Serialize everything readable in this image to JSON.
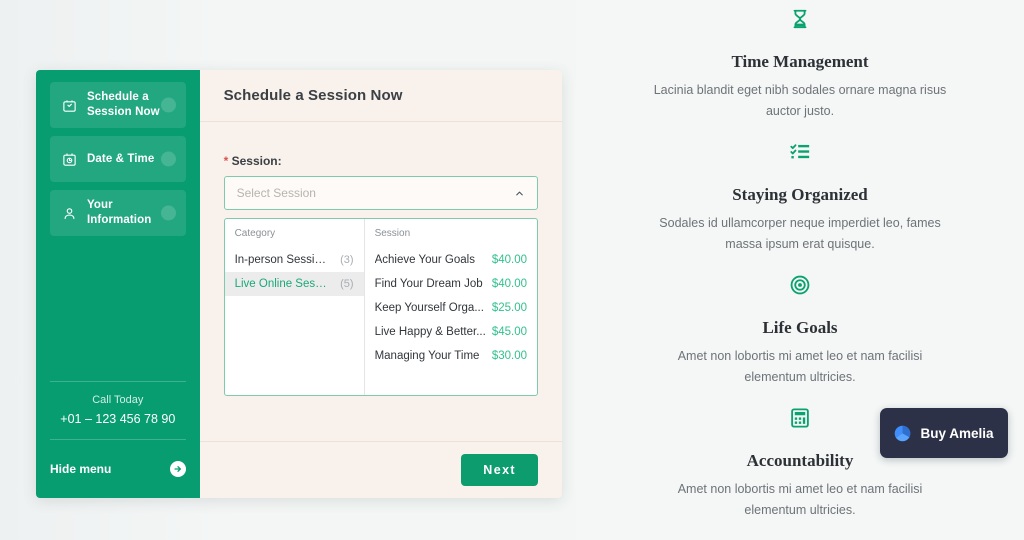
{
  "theme": {
    "sidebar_green": "#089d71",
    "panel_cream": "#f9f1eb",
    "accent_green": "#0d9c6e",
    "price_green": "#33c08d",
    "dark_navy": "#2d3148"
  },
  "booking": {
    "sidebar": {
      "nav_items": [
        {
          "label": "Schedule a Session Now",
          "icon": "bag-icon"
        },
        {
          "label": "Date & Time",
          "icon": "calendar-clock-icon"
        },
        {
          "label": "Your Information",
          "icon": "person-icon"
        }
      ],
      "call_title": "Call Today",
      "call_phone": "+01 – 123 456 78 90",
      "hide_menu_label": "Hide menu",
      "hide_menu_icon": "arrow-right-circle-icon"
    },
    "header": {
      "title": "Schedule a Session Now"
    },
    "form": {
      "session_label": "Session:",
      "required_mark": "*",
      "select_placeholder": "Select Session",
      "chevron_icon": "chevron-up-icon"
    },
    "dropdown": {
      "category_header": "Category",
      "session_header": "Session",
      "categories": [
        {
          "name": "In-person Sessions",
          "count": "(3)",
          "selected": false
        },
        {
          "name": "Live Online Sessions",
          "count": "(5)",
          "selected": true
        }
      ],
      "sessions": [
        {
          "name": "Achieve Your Goals",
          "price": "$40.00"
        },
        {
          "name": "Find Your Dream Job",
          "price": "$40.00"
        },
        {
          "name": "Keep Yourself Orga...",
          "price": "$25.00"
        },
        {
          "name": "Live Happy & Better...",
          "price": "$45.00"
        },
        {
          "name": "Managing Your Time",
          "price": "$30.00"
        }
      ]
    },
    "footer": {
      "next_label": "Next"
    }
  },
  "features": [
    {
      "icon": "hourglass-icon",
      "title": "Time Management",
      "text": "Lacinia blandit eget nibh sodales ornare magna risus auctor justo."
    },
    {
      "icon": "checklist-icon",
      "title": "Staying Organized",
      "text": "Sodales id ullamcorper neque imperdiet leo, fames massa ipsum erat quisque."
    },
    {
      "icon": "target-icon",
      "title": "Life Goals",
      "text": "Amet non lobortis mi amet leo et nam facilisi elementum ultricies."
    },
    {
      "icon": "calculator-icon",
      "title": "Accountability",
      "text": "Amet non lobortis mi amet leo et nam facilisi elementum ultricies."
    }
  ],
  "buy_amelia": {
    "label": "Buy Amelia",
    "icon": "amelia-logo-icon"
  }
}
